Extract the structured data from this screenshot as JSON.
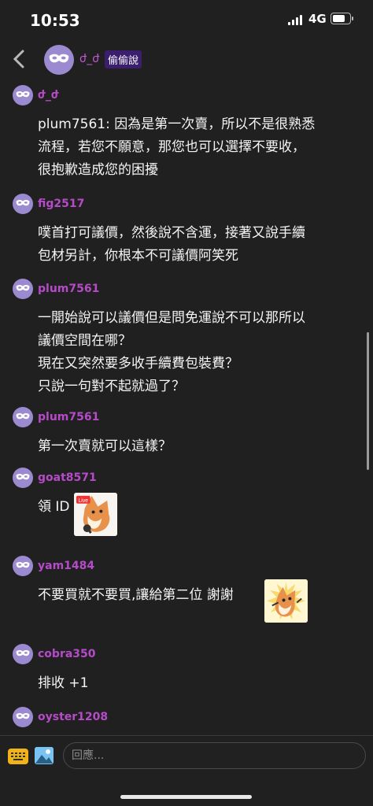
{
  "status_bar": {
    "time": "10:53",
    "network": "4G"
  },
  "header": {
    "name": "ժ_ժ",
    "badge": "偷偷說"
  },
  "messages": [
    {
      "user": "ժ_ժ",
      "lines": [
        "plum7561: 因為是第一次賣，所以不是很熟悉",
        "流程，若您不願意，那您也可以選擇不要收，",
        "很抱歉造成您的困擾"
      ]
    },
    {
      "user": "fig2517",
      "lines": [
        "噗首打可議價，然後說不含運，接著又說手續",
        "包材另計，你根本不可議價阿笑死"
      ]
    },
    {
      "user": "plum7561",
      "lines": [
        "一開始說可以議價但是問免運說不可以那所以",
        "議價空間在哪？",
        "現在又突然要多收手續費包裝費？",
        "只說一句對不起就過了？"
      ]
    },
    {
      "user": "plum7561",
      "lines": [
        "第一次賣就可以這樣？"
      ]
    },
    {
      "user": "goat8571",
      "lines": [
        "領 ID"
      ],
      "sticker": "fox-live-sticker"
    },
    {
      "user": "yam1484",
      "lines": [
        "不要買就不要買,讓給第二位 謝謝"
      ],
      "sticker": "fox-dancing-sticker"
    },
    {
      "user": "cobra350",
      "lines": [
        "排收 +1"
      ]
    },
    {
      "user": "oyster1208",
      "lines": []
    }
  ],
  "composer": {
    "placeholder": "回應..."
  },
  "icons": {
    "back": "chevron-left-icon",
    "keyboard": "keyboard-icon",
    "image": "image-icon",
    "avatar": "mask-icon"
  },
  "colors": {
    "background": "#202020",
    "username": "#b64bc9",
    "avatar": "#9b8ad0",
    "badge": "#3b1f6e",
    "keyboard_icon": "#f0b41a",
    "image_icon": "#79c4f2"
  }
}
